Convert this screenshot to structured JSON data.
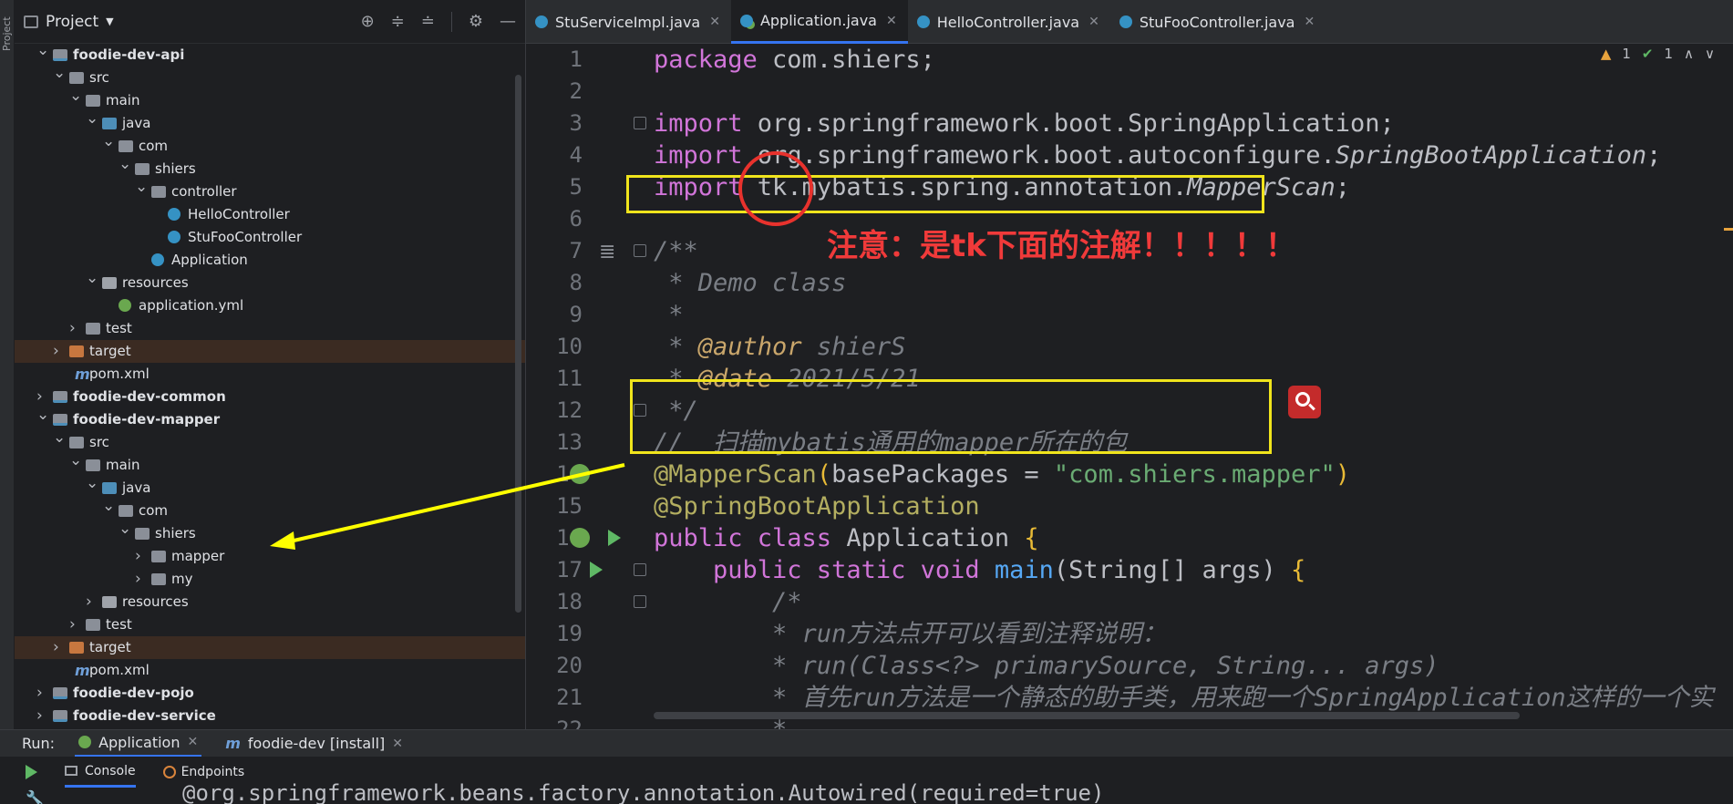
{
  "left_stripe": {
    "project_tab": "Project"
  },
  "project_panel": {
    "title": "Project",
    "tree": [
      {
        "label": "foodie-dev-api",
        "kind": "module",
        "depth": 0,
        "open": true,
        "bold": true
      },
      {
        "label": "src",
        "kind": "folder",
        "depth": 1,
        "open": true
      },
      {
        "label": "main",
        "kind": "folder",
        "depth": 2,
        "open": true
      },
      {
        "label": "java",
        "kind": "src",
        "depth": 3,
        "open": true
      },
      {
        "label": "com",
        "kind": "pkg",
        "depth": 4,
        "open": true
      },
      {
        "label": "shiers",
        "kind": "pkg",
        "depth": 5,
        "open": true
      },
      {
        "label": "controller",
        "kind": "pkg",
        "depth": 6,
        "open": true
      },
      {
        "label": "HelloController",
        "kind": "class",
        "depth": 7
      },
      {
        "label": "StuFooController",
        "kind": "class",
        "depth": 7
      },
      {
        "label": "Application",
        "kind": "class",
        "depth": 6
      },
      {
        "label": "resources",
        "kind": "res",
        "depth": 3,
        "open": true
      },
      {
        "label": "application.yml",
        "kind": "yml",
        "depth": 4
      },
      {
        "label": "test",
        "kind": "folder",
        "depth": 2,
        "open": false
      },
      {
        "label": "target",
        "kind": "target",
        "depth": 1,
        "open": false,
        "selected": true
      },
      {
        "label": "pom.xml",
        "kind": "maven",
        "depth": 1
      },
      {
        "label": "foodie-dev-common",
        "kind": "module",
        "depth": 0,
        "open": false,
        "bold": true
      },
      {
        "label": "foodie-dev-mapper",
        "kind": "module",
        "depth": 0,
        "open": true,
        "bold": true
      },
      {
        "label": "src",
        "kind": "folder",
        "depth": 1,
        "open": true
      },
      {
        "label": "main",
        "kind": "folder",
        "depth": 2,
        "open": true
      },
      {
        "label": "java",
        "kind": "src",
        "depth": 3,
        "open": true
      },
      {
        "label": "com",
        "kind": "pkg",
        "depth": 4,
        "open": true
      },
      {
        "label": "shiers",
        "kind": "pkg",
        "depth": 5,
        "open": true
      },
      {
        "label": "mapper",
        "kind": "pkg",
        "depth": 6,
        "open": false
      },
      {
        "label": "my",
        "kind": "pkg",
        "depth": 6,
        "open": false
      },
      {
        "label": "resources",
        "kind": "res",
        "depth": 3,
        "open": false
      },
      {
        "label": "test",
        "kind": "folder",
        "depth": 2,
        "open": false
      },
      {
        "label": "target",
        "kind": "target",
        "depth": 1,
        "open": false,
        "selected": true
      },
      {
        "label": "pom.xml",
        "kind": "maven",
        "depth": 1
      },
      {
        "label": "foodie-dev-pojo",
        "kind": "module",
        "depth": 0,
        "open": false,
        "bold": true
      },
      {
        "label": "foodie-dev-service",
        "kind": "module",
        "depth": 0,
        "open": false,
        "bold": true
      }
    ]
  },
  "editor_tabs": [
    {
      "label": "StuServiceImpl.java",
      "active": false
    },
    {
      "label": "Application.java",
      "active": true
    },
    {
      "label": "HelloController.java",
      "active": false
    },
    {
      "label": "StuFooController.java",
      "active": false
    }
  ],
  "inspections": {
    "warnings": "1",
    "ok": "1"
  },
  "line_numbers": [
    "1",
    "2",
    "3",
    "4",
    "5",
    "6",
    "7",
    "8",
    "9",
    "10",
    "11",
    "12",
    "13",
    "14",
    "15",
    "16",
    "17",
    "18",
    "19",
    "20",
    "21",
    "22"
  ],
  "code_lines": [
    [
      {
        "t": "package",
        "c": "kwp"
      },
      {
        "t": " com.shiers;"
      }
    ],
    [],
    [
      {
        "t": "import",
        "c": "kwp"
      },
      {
        "t": " org.springframework.boot.SpringApplication;"
      }
    ],
    [
      {
        "t": "import",
        "c": "kwp"
      },
      {
        "t": " org.springframework.boot.autoconfigure."
      },
      {
        "t": "SpringBootApplication",
        "c": "it"
      },
      {
        "t": ";"
      }
    ],
    [
      {
        "t": "import",
        "c": "kwp"
      },
      {
        "t": " tk.mybatis.spring.annotation."
      },
      {
        "t": "MapperScan",
        "c": "it"
      },
      {
        "t": ";"
      }
    ],
    [],
    [
      {
        "t": "/**",
        "c": "cmt"
      }
    ],
    [
      {
        "t": " * Demo class",
        "c": "cmt"
      }
    ],
    [
      {
        "t": " *",
        "c": "cmt"
      }
    ],
    [
      {
        "t": " * ",
        "c": "cmt"
      },
      {
        "t": "@author",
        "c": "tag"
      },
      {
        "t": " shierS",
        "c": "cmt"
      }
    ],
    [
      {
        "t": " * ",
        "c": "cmt"
      },
      {
        "t": "@date",
        "c": "tag"
      },
      {
        "t": " 2021/5/21",
        "c": "cmt"
      }
    ],
    [
      {
        "t": " */",
        "c": "cmt"
      }
    ],
    [
      {
        "t": "//  扫描mybatis通用的mapper所在的包",
        "c": "cmt"
      }
    ],
    [
      {
        "t": "@MapperScan",
        "c": "ann"
      },
      {
        "t": "(",
        "c": "br"
      },
      {
        "t": "basePackages = "
      },
      {
        "t": "\"com.shiers.mapper\"",
        "c": "str"
      },
      {
        "t": ")",
        "c": "br"
      }
    ],
    [
      {
        "t": "@SpringBootApplication",
        "c": "ann"
      }
    ],
    [
      {
        "t": "public class",
        "c": "kwp"
      },
      {
        "t": " Application "
      },
      {
        "t": "{",
        "c": "br"
      }
    ],
    [
      {
        "t": "    public static void",
        "c": "kwp"
      },
      {
        "t": " "
      },
      {
        "t": "main",
        "c": "fn"
      },
      {
        "t": "(String[] args) "
      },
      {
        "t": "{",
        "c": "br"
      }
    ],
    [
      {
        "t": "        /*",
        "c": "cmt"
      }
    ],
    [
      {
        "t": "        * run方法点开可以看到注释说明：",
        "c": "cmt"
      }
    ],
    [
      {
        "t": "        * run(Class<?> primarySource, String... args)",
        "c": "cmt"
      }
    ],
    [
      {
        "t": "        * 首先run方法是一个静态的助手类，用来跑一个SpringApplication这样的一个实",
        "c": "cmt"
      }
    ],
    [
      {
        "t": "        *",
        "c": "cmt"
      }
    ]
  ],
  "annotation_note": "注意：是tk下面的注解！！！！！",
  "run_panel": {
    "run_label": "Run:",
    "tabs": [
      {
        "label": "Application",
        "active": true
      },
      {
        "label": "foodie-dev [install]",
        "active": false
      }
    ],
    "subtabs": [
      {
        "label": "Console",
        "active": true
      },
      {
        "label": "Endpoints",
        "active": false
      }
    ],
    "console_line": "@org.springframework.beans.factory.annotation.Autowired(required=true)"
  },
  "colors": {
    "highlight_box": "#f0e41c",
    "circle": "#e8322d",
    "note": "#f03a3a",
    "arrow": "#ffff00"
  },
  "icons": [
    "project-icon",
    "locate-icon",
    "expand-all-icon",
    "collapse-all-icon",
    "gear-icon",
    "hide-icon",
    "warning-icon",
    "check-icon",
    "chevron-up-icon",
    "chevron-down-icon",
    "search-badge-icon",
    "run-gutter-icon",
    "spring-bean-icon",
    "play-icon",
    "console-icon",
    "endpoints-icon",
    "wrench-icon"
  ]
}
